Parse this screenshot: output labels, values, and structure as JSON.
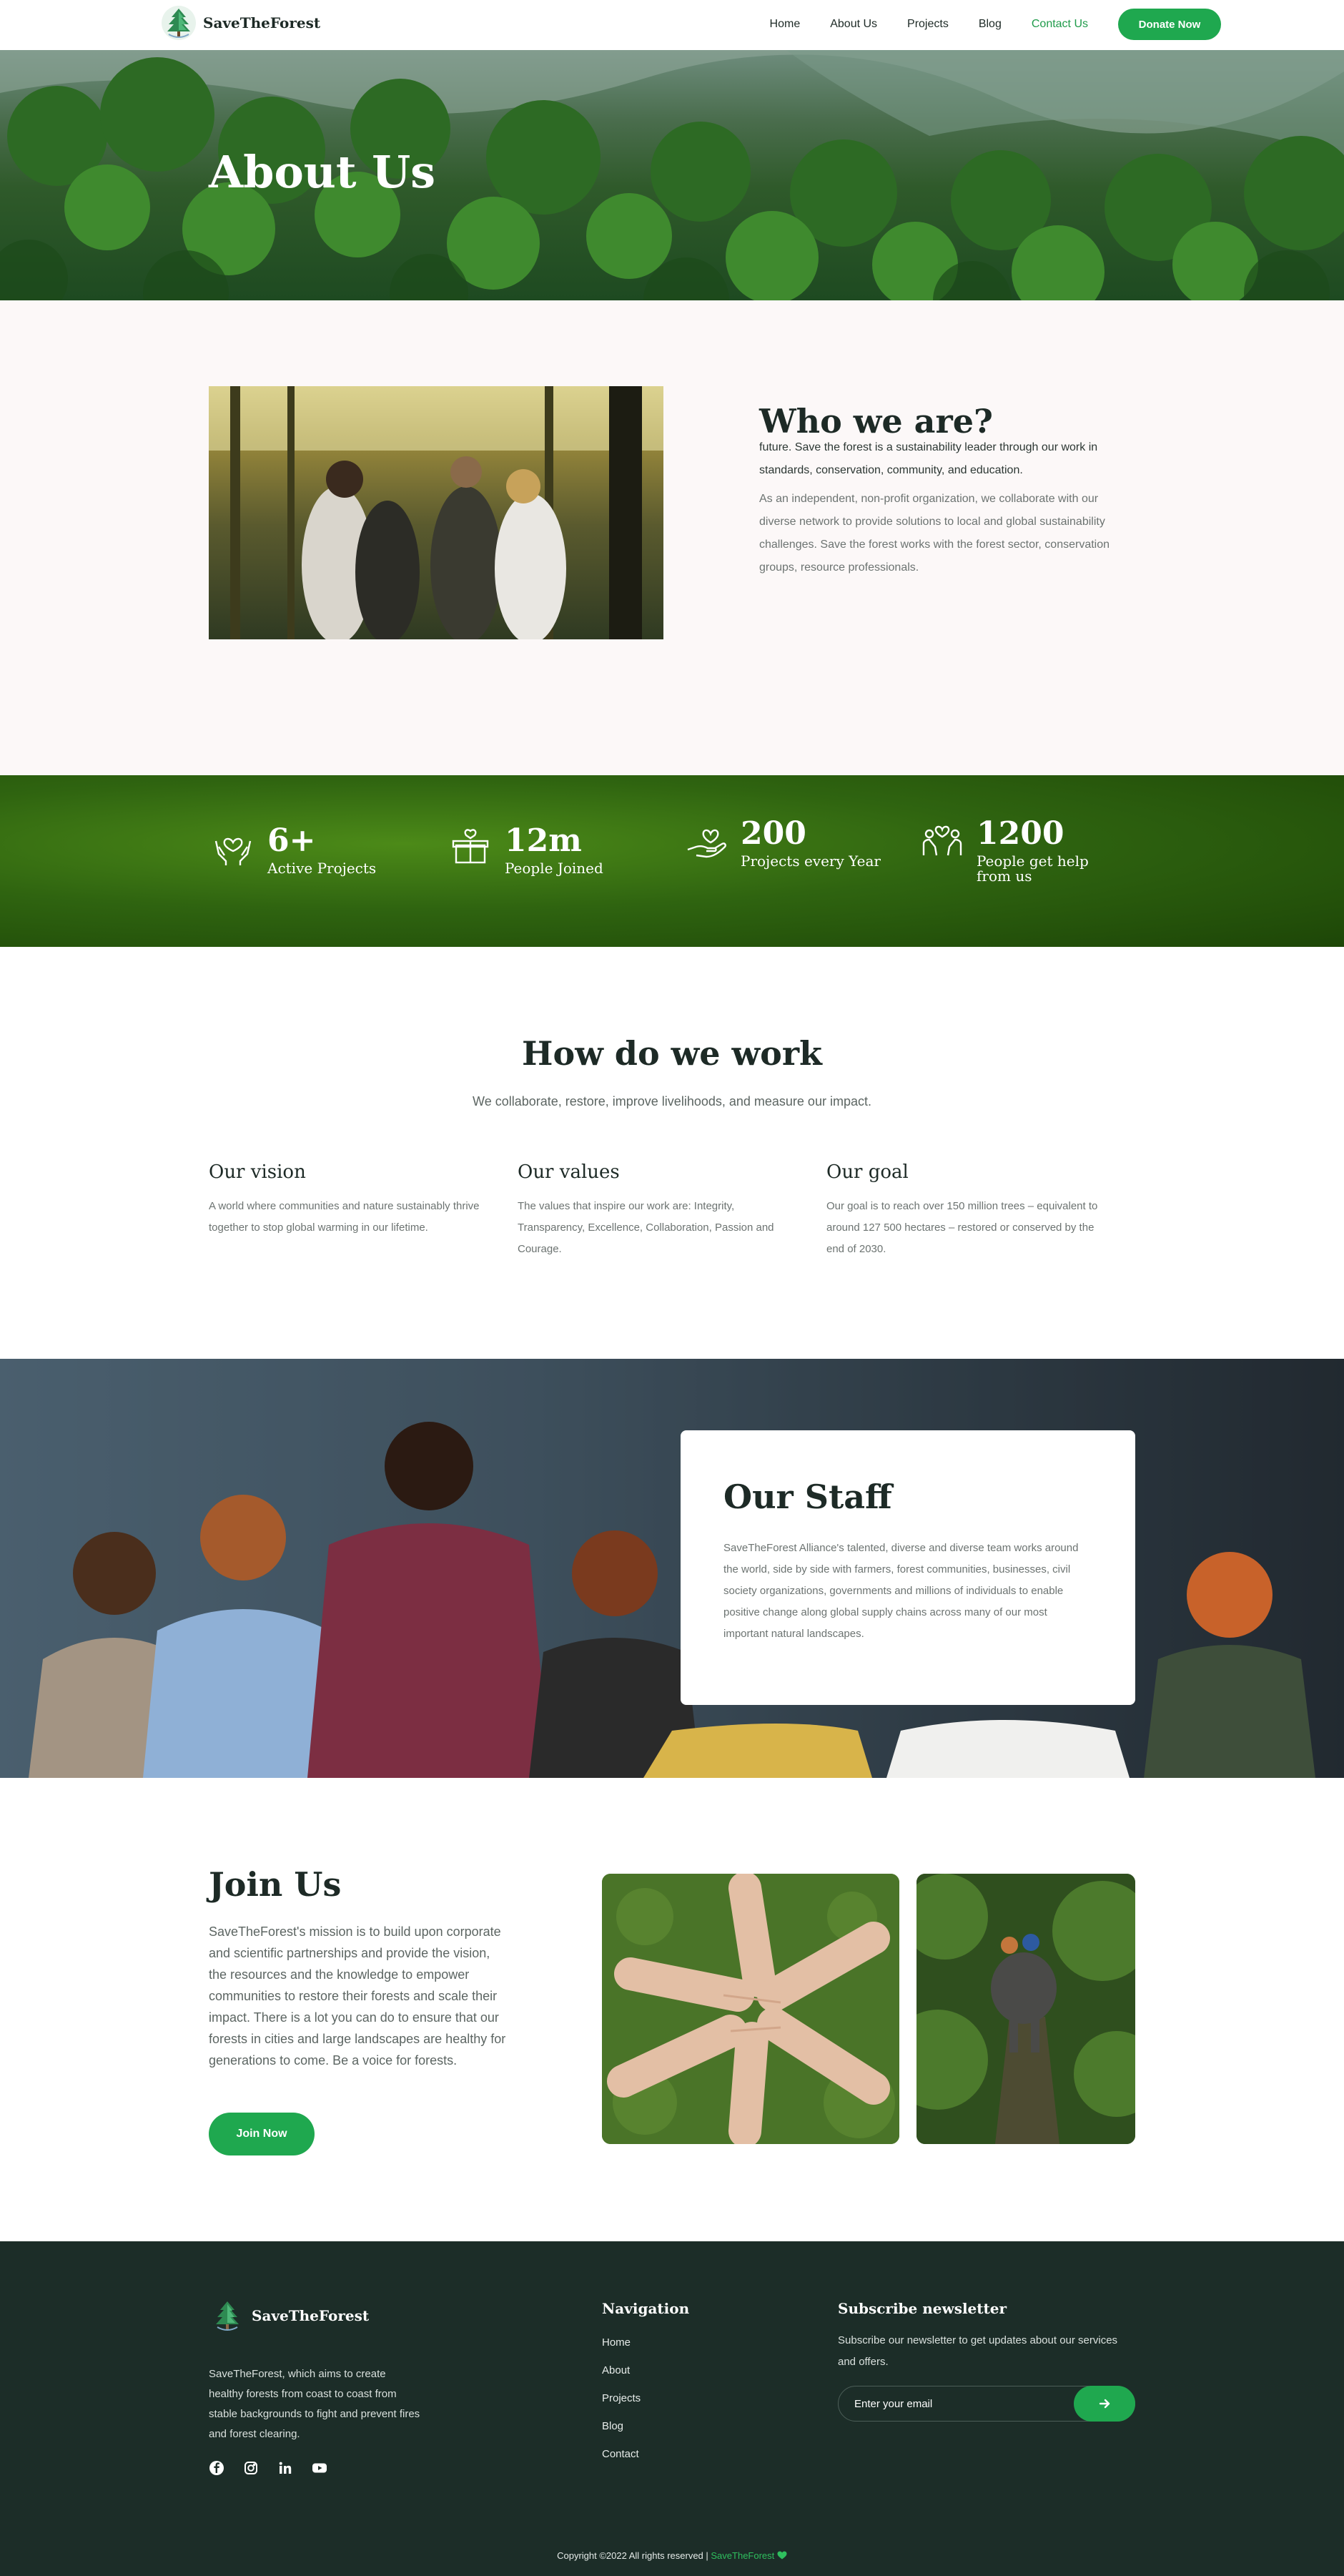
{
  "header": {
    "logo_text": "SaveTheForest",
    "nav": [
      {
        "label": "Home"
      },
      {
        "label": "About Us"
      },
      {
        "label": "Projects"
      },
      {
        "label": "Blog"
      },
      {
        "label": "Contact Us"
      }
    ],
    "donate_label": "Donate Now"
  },
  "hero": {
    "title": "About Us"
  },
  "who": {
    "title": "Who we are?",
    "lead": "future. Save the forest is a sustainability leader through our work in standards, conservation, community, and education.",
    "body": "As an independent, non-profit organization, we collaborate with our diverse network to provide solutions to local and global sustainability challenges. Save the forest works with the forest sector, conservation groups, resource professionals."
  },
  "stats": [
    {
      "icon": "hands-heart-icon",
      "value": "6+",
      "label": "Active Projects"
    },
    {
      "icon": "gift-box-icon",
      "value": "12m",
      "label": "People Joined"
    },
    {
      "icon": "hand-heart-icon",
      "value": "200",
      "label": "Projects every Year"
    },
    {
      "icon": "people-heart-icon",
      "value": "1200",
      "label": "People get help from us"
    }
  ],
  "how": {
    "title": "How do we work",
    "subtitle": "We collaborate, restore, improve livelihoods, and measure our impact.",
    "columns": [
      {
        "title": "Our vision",
        "text": "A world where communities and nature sustainably thrive together to stop global warming in our lifetime."
      },
      {
        "title": "Our values",
        "text": "The values that inspire our work are: Integrity, Transparency, Excellence, Collaboration, Passion and Courage."
      },
      {
        "title": "Our goal",
        "text": "Our goal is to reach over 150 million trees – equivalent to around 127 500 hectares – restored or conserved by the end of 2030."
      }
    ]
  },
  "staff": {
    "title": "Our Staff",
    "text": "SaveTheForest Alliance's talented, diverse and diverse team works around the world, side by side with farmers, forest communities, businesses, civil society organizations, governments and millions of individuals to enable positive change along global supply chains across many of our most important natural landscapes."
  },
  "join": {
    "title": "Join Us",
    "text": "SaveTheForest's mission is to build upon corporate and scientific partnerships and provide the vision, the resources and the knowledge to empower communities to restore their forests and scale their impact. There is a lot you can do to ensure that our forests in cities and large landscapes are healthy for generations to come. Be a voice for forests.",
    "button": "Join Now"
  },
  "footer": {
    "logo_text": "SaveTheForest",
    "description": "SaveTheForest, which aims to create healthy forests from coast to coast from stable backgrounds to fight and prevent fires and forest clearing.",
    "social_icons": [
      "facebook-icon",
      "instagram-icon",
      "linkedin-icon",
      "youtube-icon"
    ],
    "nav_title": "Navigation",
    "nav": [
      {
        "label": "Home"
      },
      {
        "label": "About"
      },
      {
        "label": "Projects"
      },
      {
        "label": "Blog"
      },
      {
        "label": "Contact"
      }
    ],
    "subscribe_title": "Subscribe newsletter",
    "subscribe_text": "Subscribe our newsletter to get updates about our services and offers.",
    "email_placeholder": "Enter your email",
    "copyright": "Copyright ©2022 All rights reserved |",
    "copyright_brand": "SaveTheForest"
  },
  "colors": {
    "accent": "#1fa84f",
    "dark": "#1c2d28",
    "active_nav": "#1f9b4a"
  }
}
